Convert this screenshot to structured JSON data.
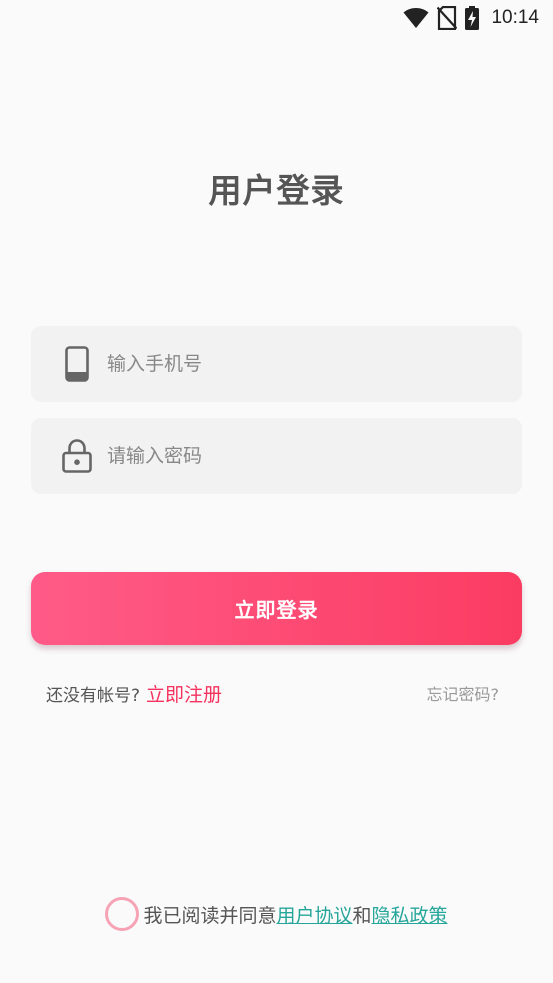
{
  "status_bar": {
    "time": "10:14",
    "icons": [
      "wifi-icon",
      "no-sim-icon",
      "battery-charging-icon"
    ]
  },
  "page": {
    "title": "用户登录"
  },
  "phone_field": {
    "icon": "phone-icon",
    "placeholder": "输入手机号",
    "value": ""
  },
  "password_field": {
    "icon": "lock-icon",
    "placeholder": "请输入密码",
    "value": ""
  },
  "login_button": {
    "label": "立即登录"
  },
  "register": {
    "prompt": "还没有帐号?",
    "link": "立即注册"
  },
  "forgot_password": {
    "label": "忘记密码?"
  },
  "agreement": {
    "checked": false,
    "prefix": "我已阅读并同意",
    "user_agreement": "用户协议",
    "conjunction": "和",
    "privacy_policy": "隐私政策"
  },
  "colors": {
    "accent": "#f5325e",
    "button_gradient_start": "#ff5b88",
    "button_gradient_end": "#fb3c62",
    "link": "#26a69a",
    "checkbox_border": "#f7a3b6",
    "input_background": "#f2f2f2"
  }
}
